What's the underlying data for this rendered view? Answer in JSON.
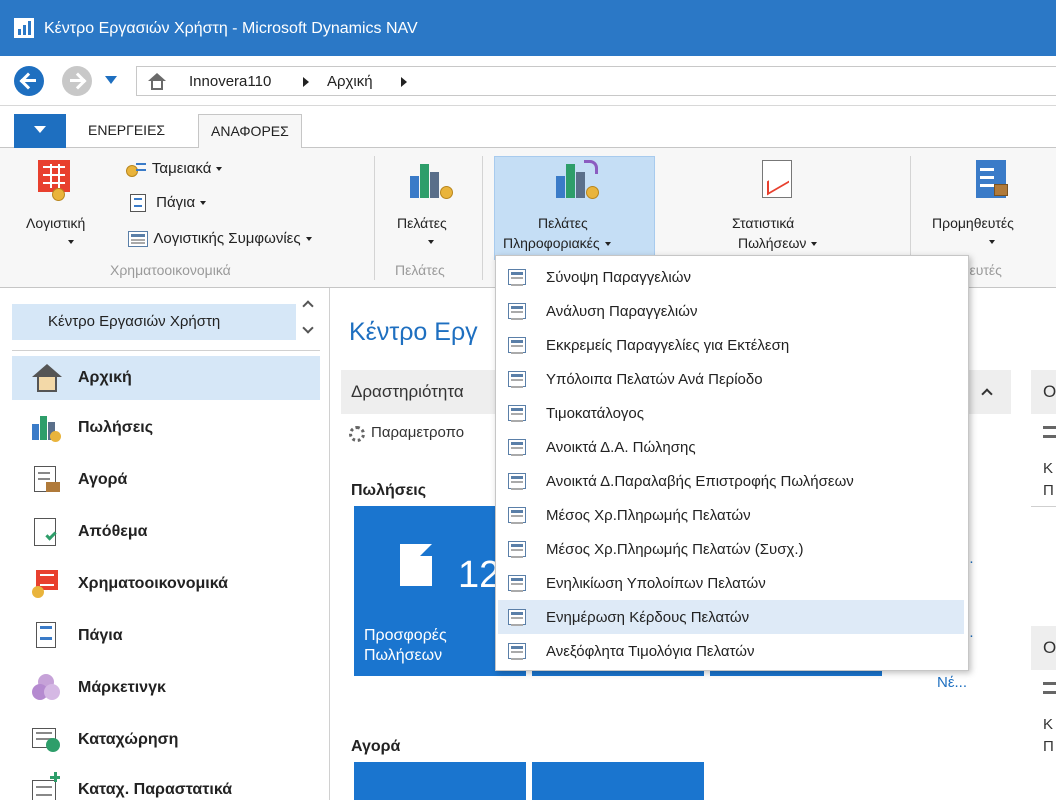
{
  "window": {
    "title": "Κέντρο Εργασιών Χρήστη - Microsoft Dynamics NAV"
  },
  "address": {
    "crumbs": [
      "Innovera110",
      "Αρχική"
    ]
  },
  "ribbon": {
    "tabs": [
      {
        "label": "ΕΝΕΡΓΕΙΕΣ",
        "active": false
      },
      {
        "label": "ΑΝΑΦΟΡΕΣ",
        "active": true
      }
    ],
    "groups": [
      {
        "label": "Χρηματοοικονομικά",
        "large_buttons": [
          {
            "label": "Λογιστική"
          }
        ],
        "small_buttons": [
          {
            "label": "Ταμειακά"
          },
          {
            "label": "Πάγια"
          },
          {
            "label": "Λογιστικής Συμφωνίες"
          }
        ]
      },
      {
        "label": "Πελάτες",
        "large_buttons": [
          {
            "label": "Πελάτες"
          }
        ]
      },
      {
        "label": "",
        "large_buttons": [
          {
            "label_line1": "Πελάτες",
            "label_line2": "Πληροφοριακές",
            "selected": true
          },
          {
            "label_line1": "Στατιστικά",
            "label_line2": "Πωλήσεων"
          }
        ]
      },
      {
        "label": "Προμηθευτές",
        "large_buttons": [
          {
            "label": "Προμηθευτές"
          }
        ]
      }
    ]
  },
  "dropdown_menu": {
    "items": [
      {
        "label": "Σύνοψη Παραγγελιών"
      },
      {
        "label": "Ανάλυση Παραγγελιών"
      },
      {
        "label": "Εκκρεμείς Παραγγελίες για Εκτέλεση"
      },
      {
        "label": "Υπόλοιπα Πελατών Ανά Περίοδο"
      },
      {
        "label": "Τιμοκατάλογος"
      },
      {
        "label": "Ανοικτά Δ.Α. Πώλησης"
      },
      {
        "label": "Ανοικτά Δ.Παραλαβής Επιστροφής Πωλήσεων"
      },
      {
        "label": "Μέσος Χρ.Πληρωμής Πελατών"
      },
      {
        "label": "Μέσος Χρ.Πληρωμής Πελατών (Συσχ.)"
      },
      {
        "label": "Ενηλικίωση Υπολοίπων Πελατών"
      },
      {
        "label": "Ενημέρωση Κέρδους Πελατών",
        "hover": true
      },
      {
        "label": "Ανεξόφλητα Τιμολόγια Πελατών"
      }
    ]
  },
  "nav_pane": {
    "header": "Κέντρο Εργασιών Χρήστη",
    "items": [
      {
        "label": "Αρχική",
        "icon": "home-icon",
        "selected": true
      },
      {
        "label": "Πωλήσεις",
        "icon": "sales-icon"
      },
      {
        "label": "Αγορά",
        "icon": "purchase-icon"
      },
      {
        "label": "Απόθεμα",
        "icon": "inventory-icon"
      },
      {
        "label": "Χρηματοοικονομικά",
        "icon": "finance-icon"
      },
      {
        "label": "Πάγια",
        "icon": "fixed-assets-icon"
      },
      {
        "label": "Μάρκετινγκ",
        "icon": "marketing-icon"
      },
      {
        "label": "Καταχώρηση",
        "icon": "posting-icon"
      },
      {
        "label": "Καταχ. Παραστατικά",
        "icon": "posted-documents-icon"
      }
    ]
  },
  "main": {
    "page_title": "Κέντρο Εργ",
    "activities_label": "Δραστηριότητα",
    "param_label": "Παραμετροπο",
    "sales_section": "Πωλήσεις",
    "sales_tile": {
      "count": "12",
      "label_line1": "Προσφορές",
      "label_line2": "Πωλήσεων"
    },
    "ellipsis_1": "...",
    "ellipsis_2": "...",
    "link_new": "Νέ...",
    "purchase_section": "Αγορά",
    "right_panel": {
      "box1_label": "Ο",
      "box1_line1": "Κ",
      "box1_line2": "Π",
      "box2_label": "Ο",
      "box2_line1": "Κ",
      "box2_line2": "Π"
    }
  },
  "colors": {
    "titlebar": "#2b78c6",
    "accent": "#1e6fc0",
    "tile": "#1a75cf",
    "selected": "#d6e7f7"
  }
}
